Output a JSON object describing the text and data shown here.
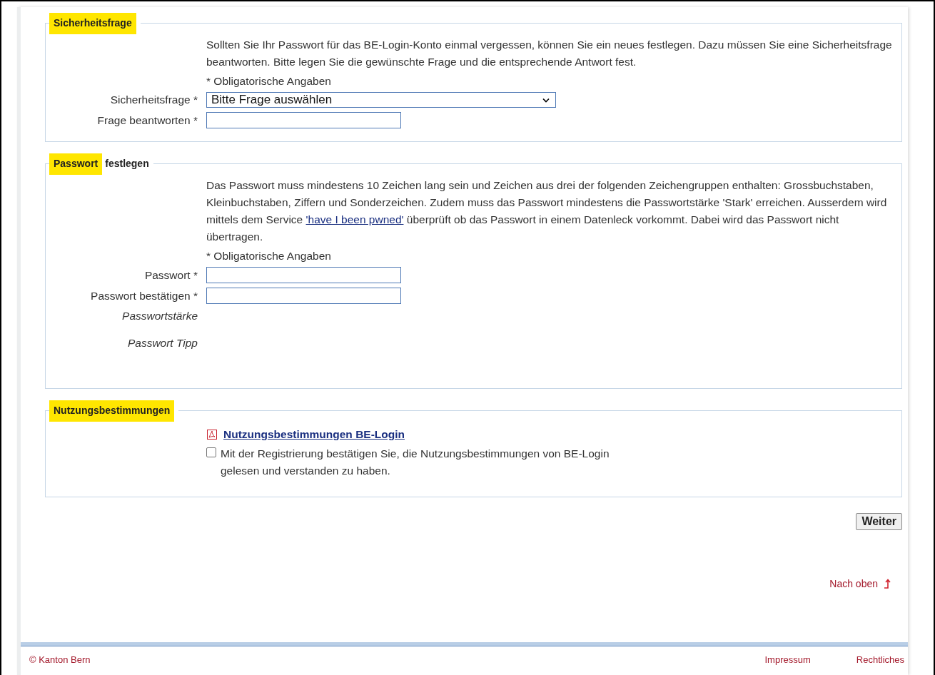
{
  "sections": [
    {
      "legend": [
        {
          "text": "Sicherheitsfrage",
          "highlighted": true
        }
      ],
      "paragraphs": [
        [
          {
            "text": "Sollten Sie Ihr Passwort für das BE-Login-Konto einmal vergessen, können Sie ein neues festlegen. Dazu müssen Sie eine Sicherheitsfrage beantworten. Bitte legen Sie die gewünschte Frage und die entsprechende Antwort fest.",
            "kind": "text"
          }
        ]
      ],
      "required_note": "* Obligatorische Angaben",
      "fields": [
        {
          "kind": "select",
          "label": "Sicherheitsfrage *",
          "value": "Bitte Frage auswählen"
        },
        {
          "kind": "input",
          "label": "Frage beantworten *"
        }
      ]
    },
    {
      "legend": [
        {
          "text": "Passwort",
          "highlighted": true
        },
        {
          "text": "festlegen",
          "highlighted": false
        }
      ],
      "paragraphs": [
        [
          {
            "text": "Das Passwort muss mindestens 10 Zeichen lang sein und Zeichen aus drei der folgenden Zeichengruppen enthalten: Grossbuchstaben, Kleinbuchstaben, Ziffern und Sonderzeichen. Zudem muss das Passwort mindestens die Passwortstärke 'Stark' erreichen. Ausserdem wird mittels dem Service ",
            "kind": "text"
          },
          {
            "text": "'have I been pwned'",
            "kind": "link"
          },
          {
            "text": " überprüft ob das Passwort in einem Datenleck vorkommt. Dabei wird das Passwort nicht übertragen.",
            "kind": "text"
          }
        ]
      ],
      "required_note": "* Obligatorische Angaben",
      "fields": [
        {
          "kind": "input",
          "label": "Passwort *"
        },
        {
          "kind": "input",
          "label": "Passwort bestätigen *"
        },
        {
          "kind": "hint",
          "label": "Passwortstärke"
        },
        {
          "kind": "hint",
          "label": "Passwort Tipp"
        }
      ]
    },
    {
      "legend": [
        {
          "text": "Nutzungsbestimmungen",
          "highlighted": true
        }
      ],
      "document_link": "Nutzungsbestimmungen BE-Login",
      "consent": {
        "checked": false,
        "text": "Mit der Registrierung bestätigen Sie, die Nutzungsbestimmungen von BE-Login gelesen und verstanden zu haben."
      }
    }
  ],
  "next_button": "Weiter",
  "back_to_top": "Nach oben",
  "footer": {
    "copyright": "© Kanton Bern",
    "links": [
      "Impressum",
      "Rechtliches"
    ]
  }
}
